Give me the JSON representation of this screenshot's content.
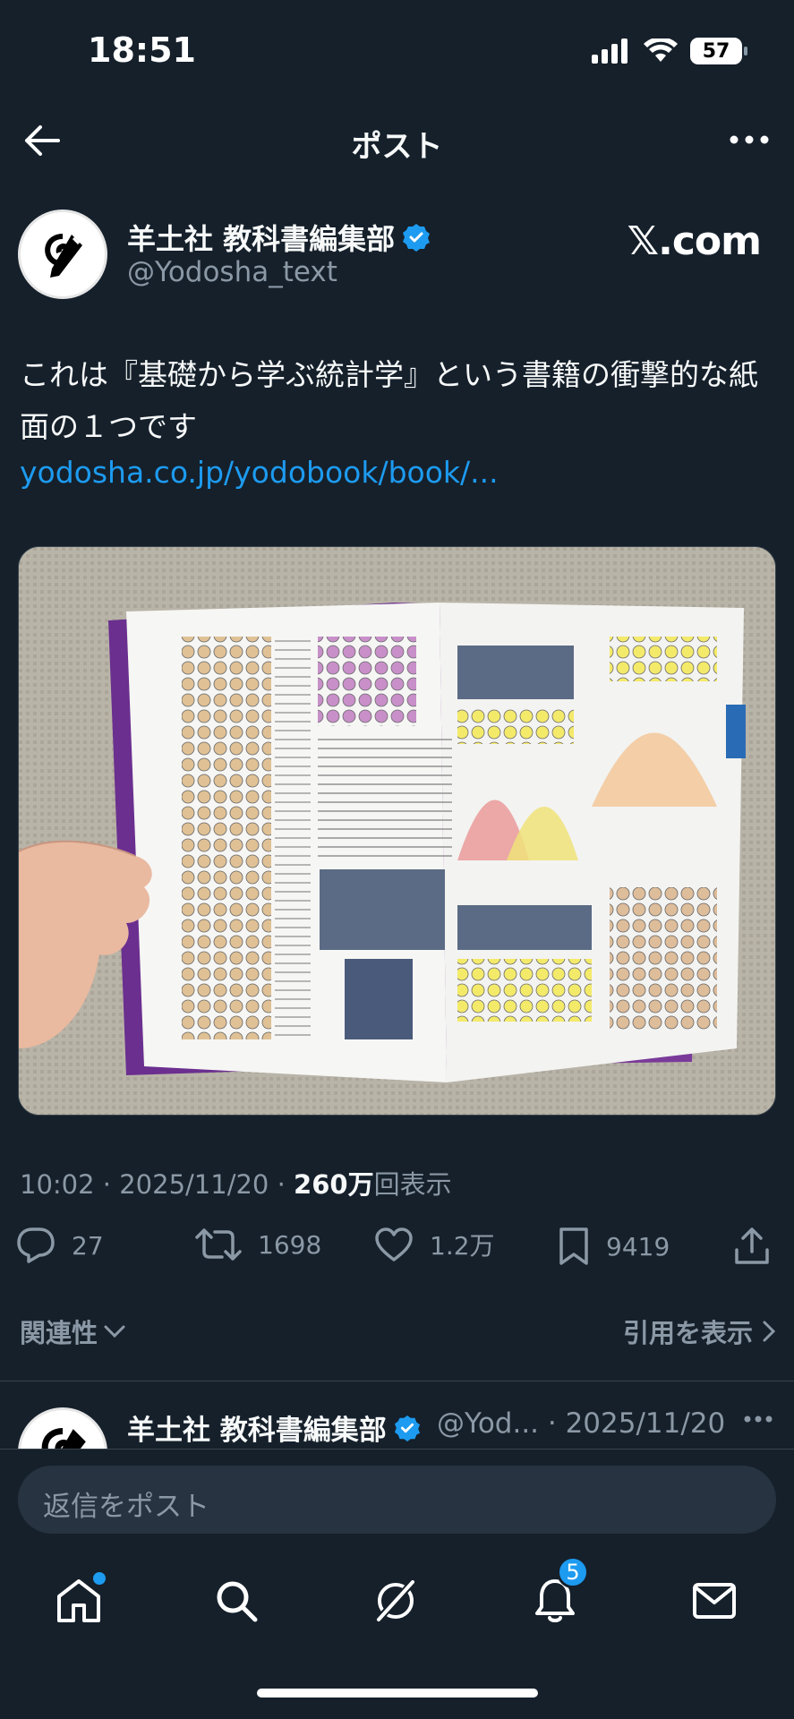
{
  "status_bar": {
    "time": "18:51",
    "battery": "57"
  },
  "nav": {
    "title": "ポスト"
  },
  "author": {
    "name": "羊土社 教科書編集部",
    "handle": "@Yodosha_text",
    "source": "𝕏.com"
  },
  "post": {
    "text": "これは『基礎から学ぶ統計学』という書籍の衝撃的な紙面の１つです",
    "link": "yodosha.co.jp/yodobook/book/..."
  },
  "meta": {
    "time_date": "10:02 · 2025/11/20 · ",
    "views": "260万",
    "views_suffix": "回表示"
  },
  "actions": {
    "replies": "27",
    "reposts": "1698",
    "likes": "1.2万",
    "bookmarks": "9419"
  },
  "sort": {
    "left": "関連性",
    "right": "引用を表示"
  },
  "reply_preview": {
    "name": "羊土社 教科書編集部",
    "handle_date": "@Yod... · 2025/11/20"
  },
  "compose": {
    "placeholder": "返信をポスト"
  },
  "tabs": {
    "notifications_badge": "5"
  },
  "colors": {
    "background": "#15202b",
    "accent": "#1d9bf0",
    "muted": "#8b98a5"
  }
}
